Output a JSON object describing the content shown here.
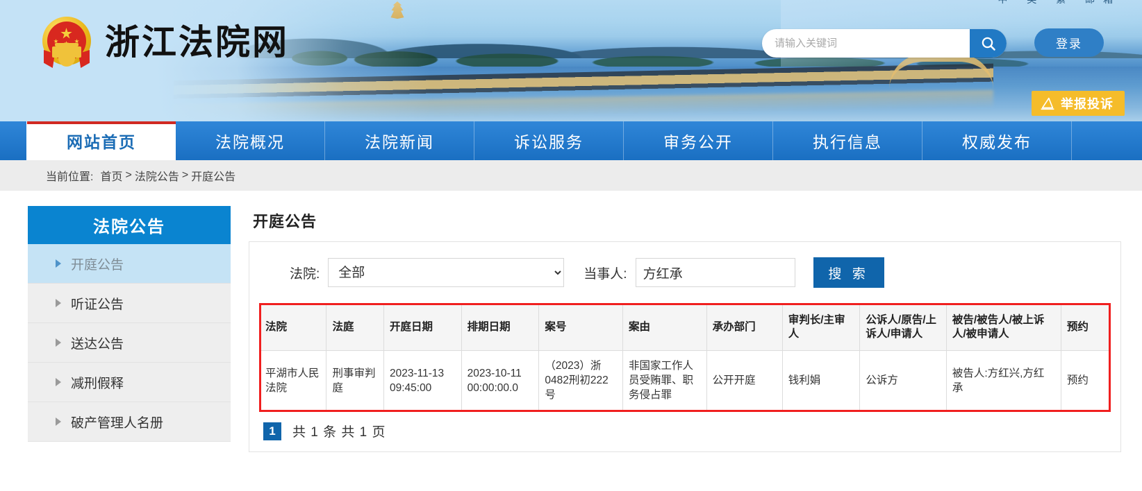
{
  "header": {
    "site_title": "浙江法院网",
    "top_links": "中 英 繁 邮箱",
    "search_placeholder": "请输入关键词",
    "search_value": "",
    "search_icon": "search-icon",
    "login_label": "登录",
    "report_label": "举报投诉",
    "report_icon": "megaphone-icon",
    "emblem_icon": "national-emblem-icon"
  },
  "nav": {
    "items": [
      {
        "label": "网站首页",
        "active": true
      },
      {
        "label": "法院概况",
        "active": false
      },
      {
        "label": "法院新闻",
        "active": false
      },
      {
        "label": "诉讼服务",
        "active": false
      },
      {
        "label": "审务公开",
        "active": false
      },
      {
        "label": "执行信息",
        "active": false
      },
      {
        "label": "权威发布",
        "active": false
      }
    ]
  },
  "breadcrumb": {
    "label": "当前位置:",
    "items": [
      "首页",
      "法院公告",
      "开庭公告"
    ],
    "sep1": ">",
    "sep2": ">"
  },
  "sidebar": {
    "title": "法院公告",
    "items": [
      {
        "label": "开庭公告",
        "active": true
      },
      {
        "label": "听证公告",
        "active": false
      },
      {
        "label": "送达公告",
        "active": false
      },
      {
        "label": "减刑假释",
        "active": false
      },
      {
        "label": "破产管理人名册",
        "active": false
      }
    ]
  },
  "main": {
    "page_title": "开庭公告",
    "filters": {
      "court_label": "法院:",
      "court_value": "全部",
      "court_options": [
        "全部"
      ],
      "party_label": "当事人:",
      "party_value": "方红承",
      "party_placeholder": "",
      "search_button": "搜 索"
    },
    "table": {
      "columns": [
        "法院",
        "法庭",
        "开庭日期",
        "排期日期",
        "案号",
        "案由",
        "承办部门",
        "审判长/主审人",
        "公诉人/原告/上诉人/申请人",
        "被告/被告人/被上诉人/被申请人",
        "预约"
      ],
      "rows": [
        {
          "court": "平湖市人民法院",
          "courtroom": "刑事审判庭",
          "hearing_date": "2023-11-13 09:45:00",
          "schedule_date": "2023-10-11 00:00:00.0",
          "case_no": "（2023）浙0482刑初222号",
          "cause": "非国家工作人员受贿罪、职务侵占罪",
          "department": "公开开庭",
          "judge": "钱利娟",
          "plaintiff": "公诉方",
          "defendant": "被告人:方红兴,方红承",
          "reserve": "预约"
        }
      ]
    },
    "pager": {
      "current_page": "1",
      "summary": "共 1 条 共 1 页"
    }
  },
  "colors": {
    "brand_blue": "#1a6fc2",
    "accent_blue": "#0a84d0",
    "button_blue": "#1065ab",
    "report_yellow": "#f5bc2a",
    "highlight_red": "#f01f1f",
    "active_tab_red": "#d02a22",
    "sidebar_active": "#c5e3f5"
  }
}
